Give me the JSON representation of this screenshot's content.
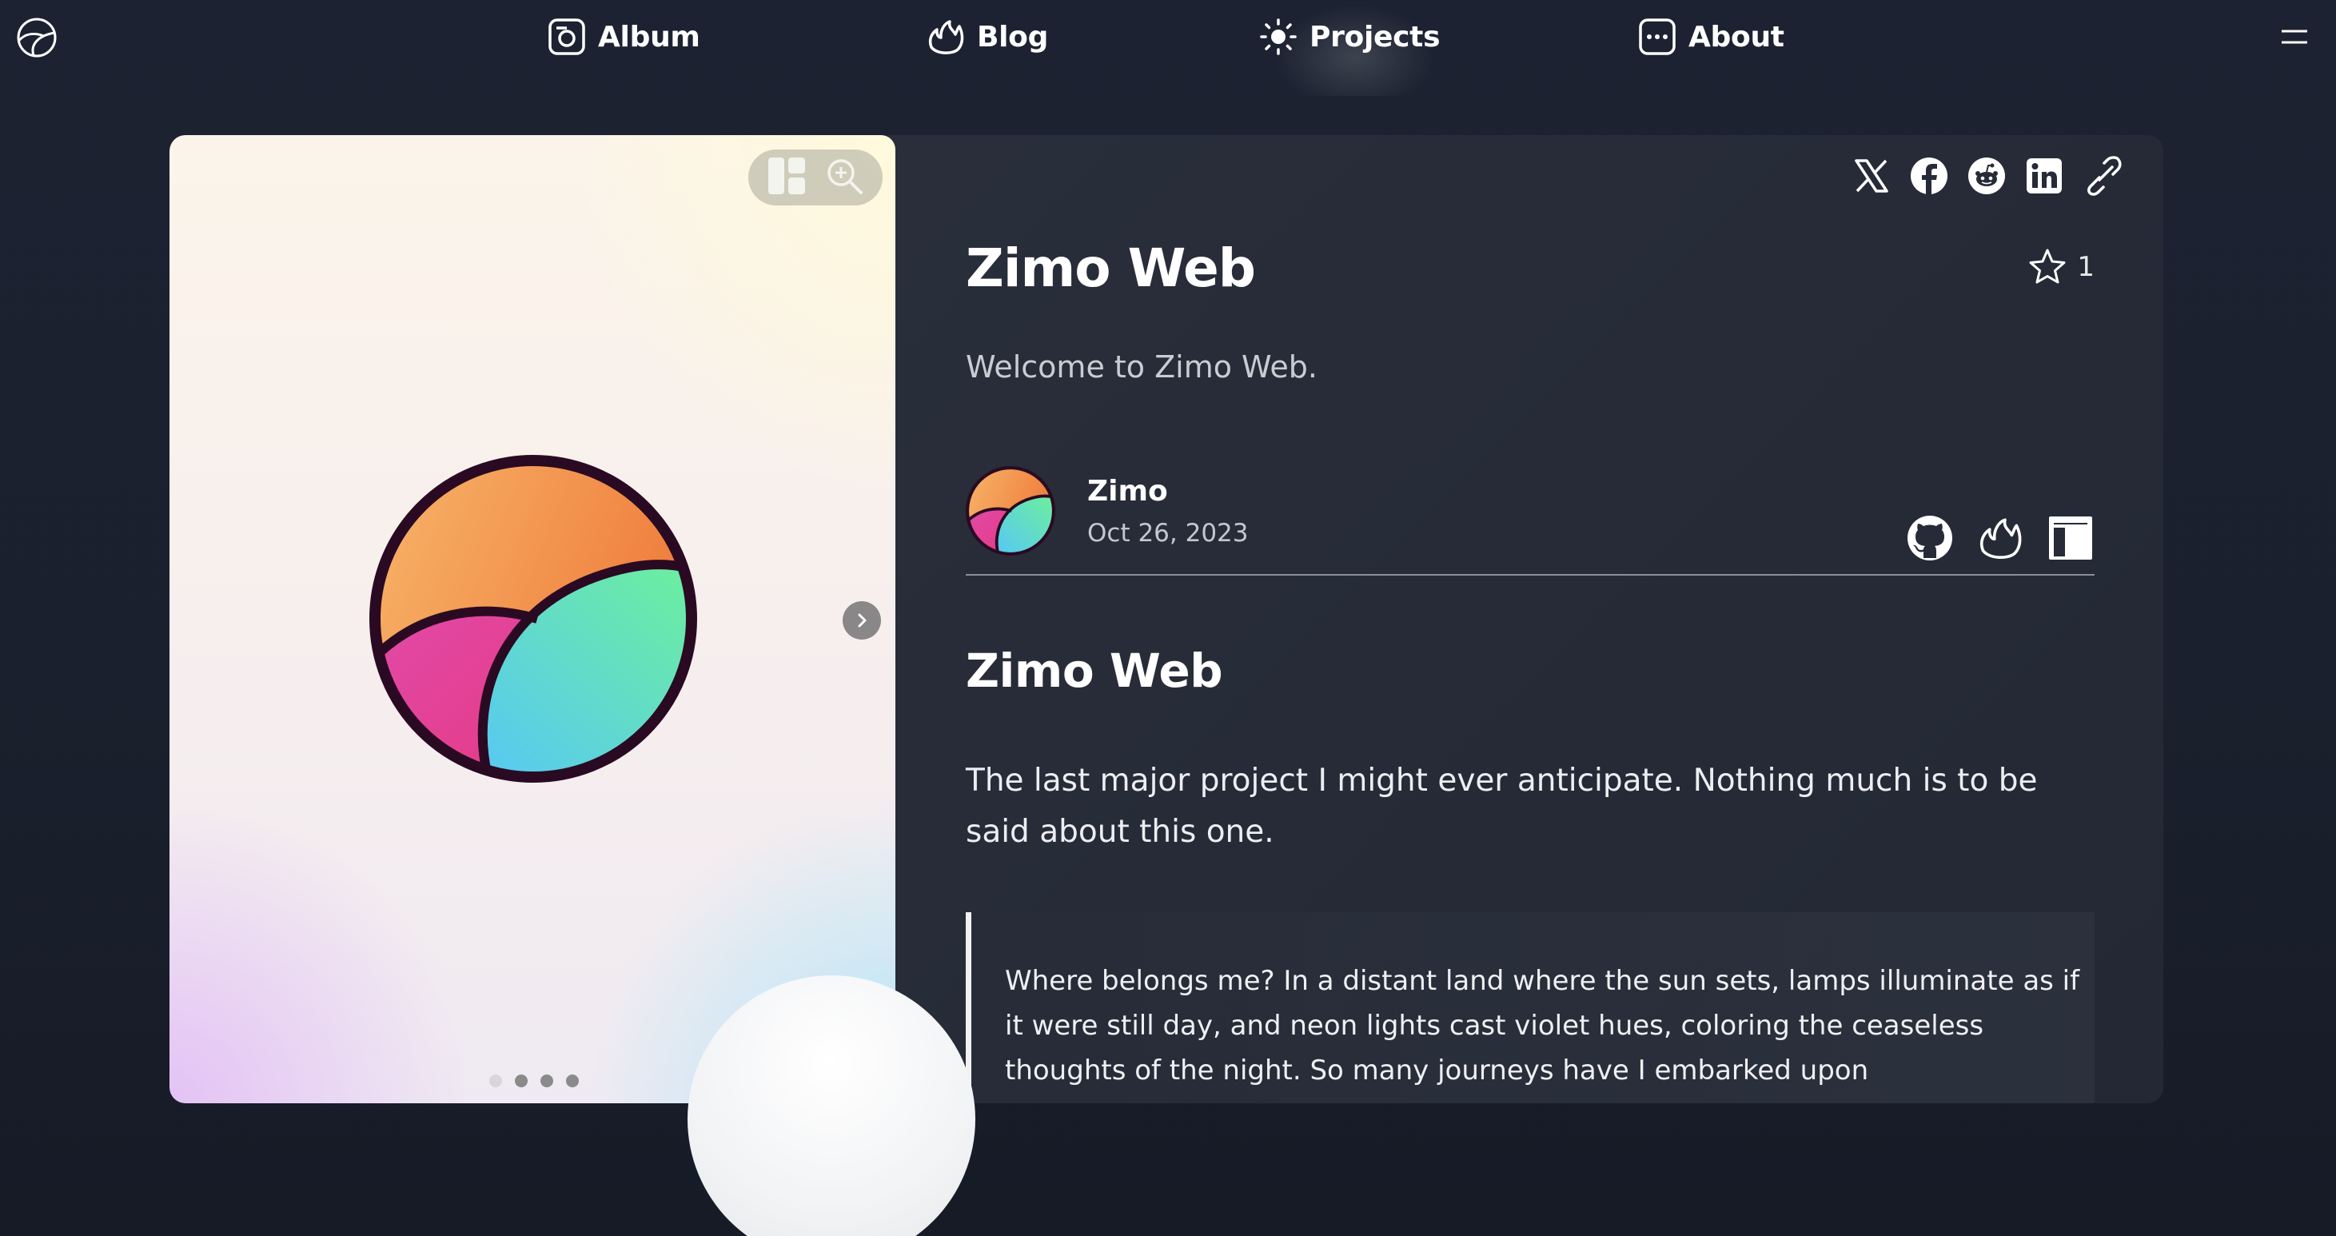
{
  "nav": {
    "items": [
      {
        "label": "Album",
        "icon": "camera-icon"
      },
      {
        "label": "Blog",
        "icon": "fire-icon"
      },
      {
        "label": "Projects",
        "icon": "sun-icon"
      },
      {
        "label": "About",
        "icon": "ellipsis-icon"
      }
    ],
    "active": "Projects",
    "logo_icon": "zimo-logo-icon",
    "menu_icon": "hamburger-icon"
  },
  "gallery": {
    "tools": [
      "layout-icon",
      "zoom-icon"
    ],
    "next_icon": "chevron-right-icon",
    "slide_count": 4,
    "active_slide": 0
  },
  "share": [
    "x-icon",
    "facebook-icon",
    "reddit-icon",
    "linkedin-icon",
    "link-icon"
  ],
  "article": {
    "title": "Zimo Web",
    "stars": "1",
    "subtitle": "Welcome to Zimo Web.",
    "author": "Zimo",
    "date": "Oct 26, 2023",
    "links": [
      "github-icon",
      "fire-icon",
      "layout-icon"
    ],
    "heading": "Zimo Web",
    "paragraph": "The last major project I might ever anticipate. Nothing much is to be said about this one.",
    "quote": "Where belongs me? In a distant land where the sun sets, lamps illuminate as if it were still day, and neon lights cast violet hues, coloring the ceaseless thoughts of the night. So many journeys have I embarked upon"
  },
  "colors": {
    "background": "#1b2130",
    "card": "#282d39",
    "logo_orange": "#f0a050",
    "logo_pink": "#e0459c",
    "logo_teal": "#5fd8c8",
    "logo_outline": "#2a0a22"
  }
}
